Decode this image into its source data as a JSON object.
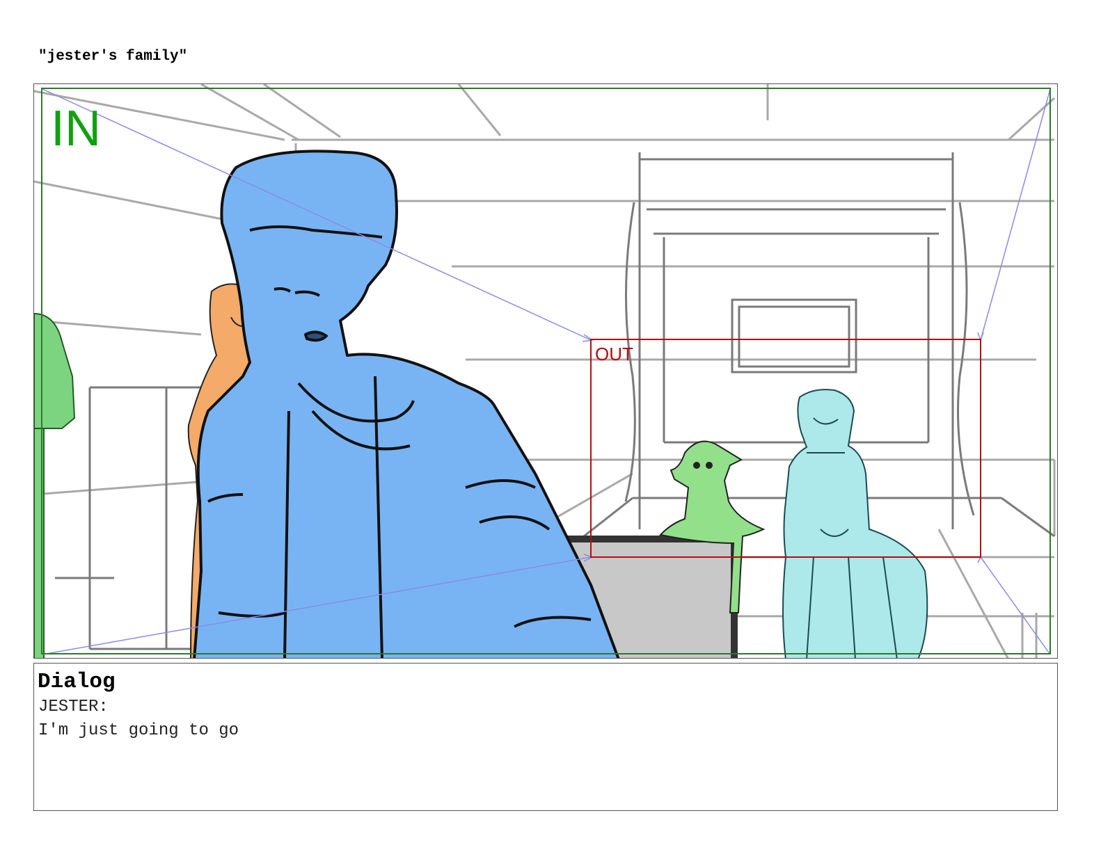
{
  "scene": {
    "title": "\"jester's family\""
  },
  "panel": {
    "camera_in_label": "IN",
    "camera_out_label": "OUT",
    "colors": {
      "in_frame": "#2a7a2a",
      "out_frame": "#b01010",
      "guide_arrows": "#8a8ae8",
      "foreground_character": "#78b4f4",
      "background_woman": "#f4aa68",
      "goblin": "#92e08a",
      "seated_woman": "#ade8ea",
      "left_edge_figure": "#7cd480",
      "crate": "#c8c8c8",
      "sketch_lines": "#9a9a9a"
    }
  },
  "dialog": {
    "heading": "Dialog",
    "speaker": "JESTER:",
    "line": "I'm just going to go"
  }
}
